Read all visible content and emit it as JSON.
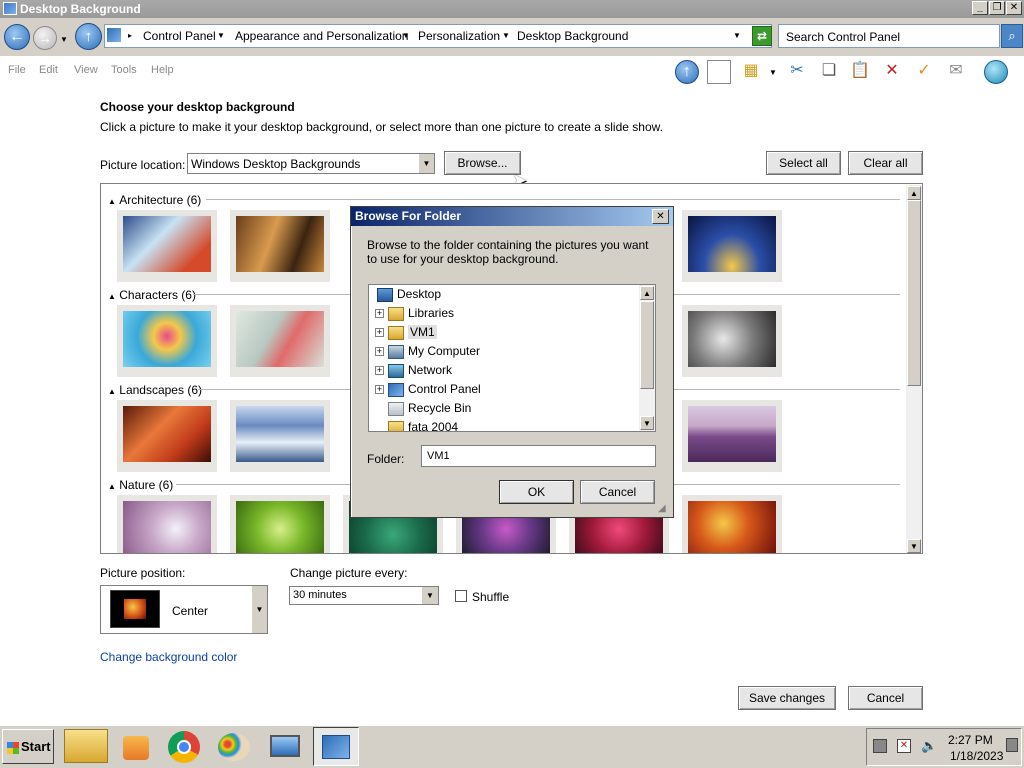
{
  "window": {
    "title": "Desktop Background"
  },
  "address": {
    "crumbs": [
      "Control Panel",
      "Appearance and Personalization",
      "Personalization",
      "Desktop Background"
    ],
    "search_placeholder": "Search Control Panel"
  },
  "menu": [
    "File",
    "Edit",
    "View",
    "Tools",
    "Help"
  ],
  "toolbar_icons": [
    "up-icon",
    "panel-icon",
    "folder-options-icon",
    "cut-icon",
    "copy-icon",
    "paste-icon",
    "delete-icon",
    "check-icon",
    "mail-icon",
    "globe-icon"
  ],
  "content": {
    "title": "Choose your desktop background",
    "subtitle": "Click a picture to make it your desktop background, or select more than one picture to create a slide show.",
    "location_label": "Picture location:",
    "location_value": "Windows Desktop Backgrounds",
    "browse_label": "Browse...",
    "select_all_label": "Select all",
    "clear_all_label": "Clear all",
    "groups": [
      {
        "label": "Architecture (6)"
      },
      {
        "label": "Characters (6)"
      },
      {
        "label": "Landscapes (6)"
      },
      {
        "label": "Nature (6)"
      }
    ]
  },
  "dialog": {
    "title": "Browse For Folder",
    "description": "Browse to the folder containing the pictures you want to use for your desktop background.",
    "tree": [
      {
        "label": "Desktop",
        "icon": "desktop-icon",
        "expandable": false
      },
      {
        "label": "Libraries",
        "icon": "libraries-icon",
        "expandable": true
      },
      {
        "label": "VM1",
        "icon": "user-folder-icon",
        "expandable": true,
        "selected": true
      },
      {
        "label": "My Computer",
        "icon": "computer-icon",
        "expandable": true
      },
      {
        "label": "Network",
        "icon": "network-icon",
        "expandable": true
      },
      {
        "label": "Control Panel",
        "icon": "control-panel-icon",
        "expandable": true
      },
      {
        "label": "Recycle Bin",
        "icon": "recycle-bin-icon",
        "expandable": false
      },
      {
        "label": "fata 2004",
        "icon": "folder-icon",
        "expandable": false
      }
    ],
    "folder_label": "Folder:",
    "folder_value": "VM1",
    "ok_label": "OK",
    "cancel_label": "Cancel"
  },
  "position": {
    "label": "Picture position:",
    "value": "Center"
  },
  "interval": {
    "label": "Change picture every:",
    "value": "30 minutes",
    "shuffle_label": "Shuffle",
    "shuffle_checked": false
  },
  "bg_color_link": "Change background color",
  "footer": {
    "save_label": "Save changes",
    "cancel_label": "Cancel"
  },
  "taskbar": {
    "start_label": "Start",
    "apps": [
      "explorer-icon",
      "media-player-icon",
      "chrome-icon",
      "paint-icon",
      "remote-desktop-icon",
      "control-panel-icon"
    ],
    "time": "2:27 PM",
    "date": "1/18/2023"
  },
  "colors": {
    "accent": "#0a246a",
    "link": "#0a3fa8",
    "chrome": "#d4d0c8"
  }
}
